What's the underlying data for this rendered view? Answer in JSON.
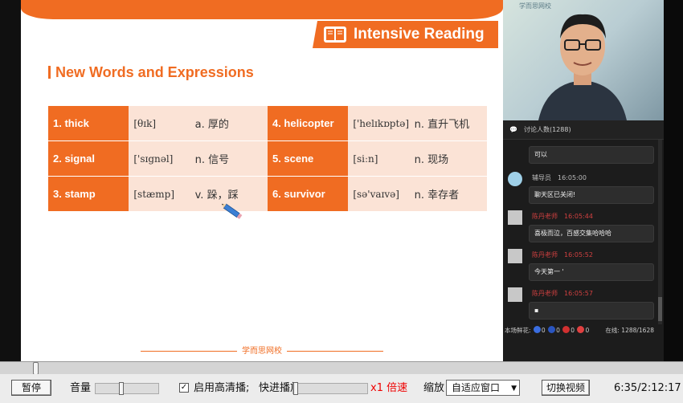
{
  "slide": {
    "badge_title": "Intensive Reading",
    "section_title": "New Words and Expressions",
    "vocab": [
      [
        {
          "word": "1. thick",
          "phon": "[θɪk]",
          "meaning": "a. 厚的"
        },
        {
          "word": "4. helicopter",
          "phon": "['helɪkɒptə]",
          "meaning": "n. 直升飞机"
        }
      ],
      [
        {
          "word": "2. signal",
          "phon": "['sɪgnəl]",
          "meaning": "n. 信号"
        },
        {
          "word": "5. scene",
          "phon": "[siːn]",
          "meaning": "n. 现场"
        }
      ],
      [
        {
          "word": "3. stamp",
          "phon": "[stæmp]",
          "meaning": "v. 跺，踩"
        },
        {
          "word": "6. survivor",
          "phon": "[sə'vaɪvə]",
          "meaning": "n. 幸存者"
        }
      ]
    ],
    "footer_brand": "学而思网校"
  },
  "video": {
    "wall_logo": "学而思网校"
  },
  "chat": {
    "header": "讨论人数(1288)",
    "messages": [
      {
        "name": "",
        "time": "",
        "text": "可以"
      },
      {
        "name": "辅导员",
        "time": "16:05:00",
        "text": "聊天区已关闭!"
      },
      {
        "name": "陈丹老师",
        "time": "16:05:44",
        "text": "喜极而泣，百感交集哈哈哈"
      },
      {
        "name": "陈丹老师",
        "time": "16:05:52",
        "text": "今天第一 '"
      },
      {
        "name": "陈丹老师",
        "time": "16:05:57",
        "text": "▪"
      }
    ],
    "stats": {
      "label": "本场鲜花:",
      "counts": [
        "0",
        "0",
        "0",
        "0"
      ],
      "online_label": "在线:",
      "online": "1288/1628"
    }
  },
  "controls": {
    "pause": "暂停",
    "volume": "音量",
    "hd_label": "启用高清播;",
    "fast_label": "快进播放",
    "speed": "x1 倍速",
    "zoom_label": "缩放",
    "zoom_value": "自适应窗口",
    "switch_video": "切换视频",
    "time": "6:35/2:12:17"
  },
  "colors": {
    "accent": "#f06c22",
    "cell_bg": "#fbe3d6",
    "chat_red": "#d04040"
  }
}
